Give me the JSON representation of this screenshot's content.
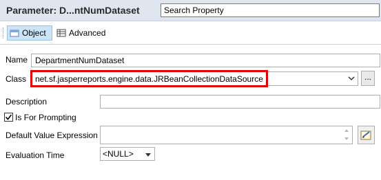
{
  "header": {
    "title": "Parameter: D...ntNumDataset",
    "search_value": "Search Property"
  },
  "tabs": [
    {
      "label": "Object",
      "active": true,
      "icon": "object-tab-icon"
    },
    {
      "label": "Advanced",
      "active": false,
      "icon": "table-icon"
    }
  ],
  "form": {
    "name_label": "Name",
    "name_value": "DepartmentNumDataset",
    "class_label": "Class",
    "class_value": "net.sf.jasperreports.engine.data.JRBeanCollectionDataSource",
    "class_browse_label": "...",
    "description_label": "Description",
    "description_value": "",
    "prompting_label": "Is For Prompting",
    "prompting_checked": true,
    "default_expr_label": "Default Value Expression",
    "default_expr_value": "",
    "eval_time_label": "Evaluation Time",
    "eval_time_value": "<NULL>"
  },
  "colors": {
    "header_bg": "#dfe6f0",
    "active_tab_bg": "#cce4f7",
    "highlight": "#e00000"
  }
}
